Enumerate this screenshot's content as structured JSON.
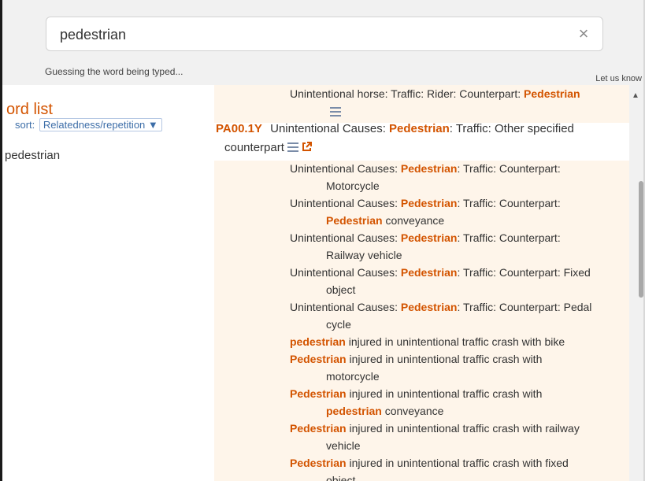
{
  "search": {
    "value": "pedestrian",
    "clear_symbol": "×",
    "status": "Guessing the word being typed...",
    "feedback_link": "Let us know"
  },
  "sidebar": {
    "title": "ord list",
    "sort_label": "sort:",
    "sort_value": "Relatedness/repetition ▼",
    "words": [
      "pedestrian"
    ]
  },
  "results": {
    "prev_entry": {
      "text": "Unintentional horse: Traffic: Rider: Counterpart: ",
      "highlight": "Pedestrian"
    },
    "entry": {
      "code": "PA00.1Y",
      "title_pre": "Unintentional Causes: ",
      "title_hl": "Pedestrian",
      "title_post": ": Traffic: Other specified",
      "title_cont": "counterpart"
    },
    "lines": [
      {
        "t1": "Unintentional Causes: ",
        "h1": "Pedestrian",
        "t2": ": Traffic: Counterpart:"
      },
      {
        "t1": "Motorcycle",
        "h1": "",
        "t2": ""
      },
      {
        "t1": "Unintentional Causes: ",
        "h1": "Pedestrian",
        "t2": ": Traffic: Counterpart:"
      },
      {
        "t1": "",
        "h1": "Pedestrian",
        "t2": " conveyance"
      },
      {
        "t1": "Unintentional Causes: ",
        "h1": "Pedestrian",
        "t2": ": Traffic: Counterpart:"
      },
      {
        "t1": "Railway vehicle",
        "h1": "",
        "t2": ""
      },
      {
        "t1": "Unintentional Causes: ",
        "h1": "Pedestrian",
        "t2": ": Traffic: Counterpart: Fixed"
      },
      {
        "t1": "object",
        "h1": "",
        "t2": ""
      },
      {
        "t1": "Unintentional Causes: ",
        "h1": "Pedestrian",
        "t2": ": Traffic: Counterpart: Pedal"
      },
      {
        "t1": "cycle",
        "h1": "",
        "t2": ""
      },
      {
        "t1": "",
        "h1": "pedestrian",
        "t2": " injured in unintentional traffic crash with bike"
      },
      {
        "t1": "",
        "h1": "Pedestrian",
        "t2": " injured in unintentional traffic crash with"
      },
      {
        "t1": "motorcycle",
        "h1": "",
        "t2": ""
      },
      {
        "t1": "",
        "h1": "Pedestrian",
        "t2": " injured in unintentional traffic crash with"
      },
      {
        "t1": "",
        "h1": "pedestrian",
        "t2": " conveyance"
      },
      {
        "t1": "",
        "h1": "Pedestrian",
        "t2": " injured in unintentional traffic crash with railway"
      },
      {
        "t1": "vehicle",
        "h1": "",
        "t2": ""
      },
      {
        "t1": "",
        "h1": "Pedestrian",
        "t2": " injured in unintentional traffic crash with fixed"
      },
      {
        "t1": "object",
        "h1": "",
        "t2": ""
      }
    ]
  },
  "colors": {
    "accent": "#d35400",
    "peach": "#fef5ea",
    "link": "#3d6ea8"
  },
  "icons": [
    "close-icon",
    "list-icon",
    "external-link-icon",
    "scroll-up-arrow-icon"
  ]
}
